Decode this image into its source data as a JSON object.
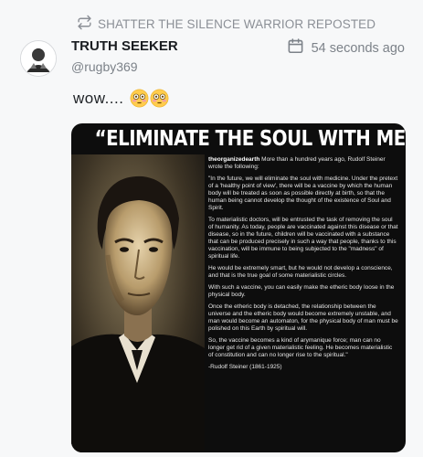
{
  "repost": {
    "label": "SHATTER THE SILENCE WARRIOR REPOSTED",
    "icon": "repost-icon"
  },
  "author": {
    "name": "TRUTH SEEKER",
    "handle": "@rugby369",
    "avatar_icon": "avatar"
  },
  "timestamp": {
    "text": "54 seconds ago",
    "icon": "calendar-icon"
  },
  "post": {
    "text": "wow....",
    "emojis": [
      "flushed-face-emoji",
      "flushed-face-emoji"
    ]
  },
  "meme": {
    "title": "“ELIMINATE THE SOUL WITH MEDICINE”",
    "source_handle": "theorganizedearth",
    "intro": " More than a hundred years ago, Rudolf Steiner wrote the following:",
    "paragraphs": [
      "\"In the future, we will eliminate the soul with medicine. Under the pretext of a 'healthy point of view', there will be a vaccine by which the human body will be treated as soon as possible directly at birth, so that the human being cannot develop the thought of the existence of Soul and Spirit.",
      "To materialistic doctors, will be entrusted the task of removing the soul of humanity. As today, people are vaccinated against this disease or that disease, so in the future, children will be vaccinated with a substance that can be produced precisely in such a way that people, thanks to this vaccination, will be immune to being subjected to the \"madness\" of spiritual life.",
      "He would be extremely smart, but he would not develop a conscience, and that is the true goal of some materialistic circles.",
      "With such a vaccine, you can easily make the etheric body loose in the physical body.",
      "Once the etheric body is detached, the relationship between the universe and the etheric body would become extremely unstable, and man would become an automaton, for the physical body of man must be polished on this Earth by spiritual will.",
      "So, the vaccine becomes a kind of arymanique force; man can no longer get rid of a given materialistic feeling. He becomes materialistic of constitution and can no longer rise to the spiritual.\"",
      "-Rudolf Steiner (1861-1925)"
    ]
  },
  "colors": {
    "page_bg": "#f7f8f9",
    "muted_text": "#7c8289",
    "meme_bg": "#0d0d0d"
  }
}
